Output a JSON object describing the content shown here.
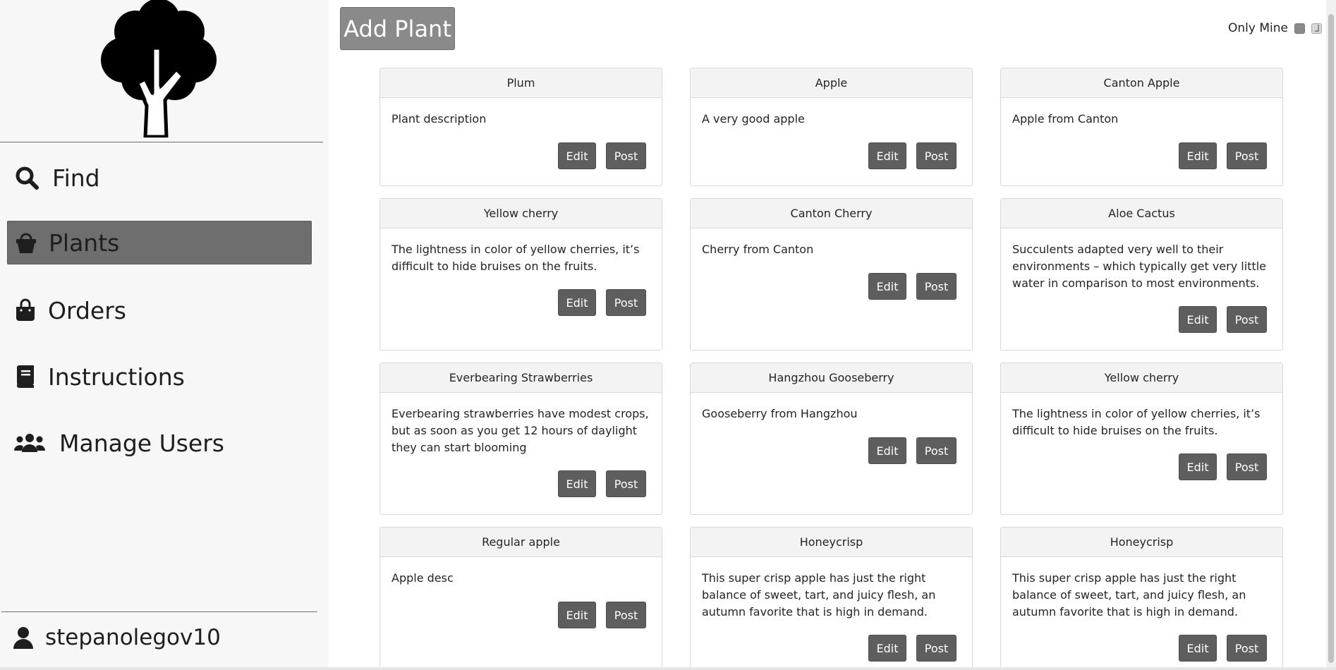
{
  "sidebar": {
    "logo_icon": "tree-icon",
    "nav": [
      {
        "label": "Find",
        "icon": "search-icon"
      },
      {
        "label": "Plants",
        "icon": "basket-icon",
        "active": true
      },
      {
        "label": "Orders",
        "icon": "shopping-bag-icon"
      },
      {
        "label": "Instructions",
        "icon": "book-icon"
      },
      {
        "label": "Manage Users",
        "icon": "users-icon"
      }
    ],
    "user": {
      "name": "stepanolegov10",
      "icon": "user-icon"
    }
  },
  "toolbar": {
    "add_label": "Add Plant",
    "only_mine_label": "Only Mine"
  },
  "cards": [
    {
      "title": "Plum",
      "description": "Plant description",
      "edit": "Edit",
      "post": "Post"
    },
    {
      "title": "Apple",
      "description": "A very good apple",
      "edit": "Edit",
      "post": "Post"
    },
    {
      "title": "Canton Apple",
      "description": "Apple from Canton",
      "edit": "Edit",
      "post": "Post"
    },
    {
      "title": "Yellow cherry",
      "description": "The lightness in color of yellow cherries, it’s difficult to hide bruises on the fruits.",
      "edit": "Edit",
      "post": "Post"
    },
    {
      "title": "Canton Cherry",
      "description": "Cherry from Canton",
      "edit": "Edit",
      "post": "Post"
    },
    {
      "title": "Aloe Cactus",
      "description": "Succulents adapted very well to their environments – which typically get very little water in comparison to most environments.",
      "edit": "Edit",
      "post": "Post"
    },
    {
      "title": "Everbearing Strawberries",
      "description": "Everbearing strawberries have modest crops, but as soon as you get 12 hours of daylight they can start blooming",
      "edit": "Edit",
      "post": "Post"
    },
    {
      "title": "Hangzhou Gooseberry",
      "description": "Gooseberry from Hangzhou",
      "edit": "Edit",
      "post": "Post"
    },
    {
      "title": "Yellow cherry",
      "description": "The lightness in color of yellow cherries, it’s difficult to hide bruises on the fruits.",
      "edit": "Edit",
      "post": "Post"
    },
    {
      "title": "Regular apple",
      "description": "Apple desc",
      "edit": "Edit",
      "post": "Post"
    },
    {
      "title": "Honeycrisp",
      "description": "This super crisp apple has just the right balance of sweet, tart, and juicy flesh, an autumn favorite that is high in demand.",
      "edit": "Edit",
      "post": "Post"
    },
    {
      "title": "Honeycrisp",
      "description": "This super crisp apple has just the right balance of sweet, tart, and juicy flesh, an autumn favorite that is high in demand.",
      "edit": "Edit",
      "post": "Post"
    }
  ]
}
